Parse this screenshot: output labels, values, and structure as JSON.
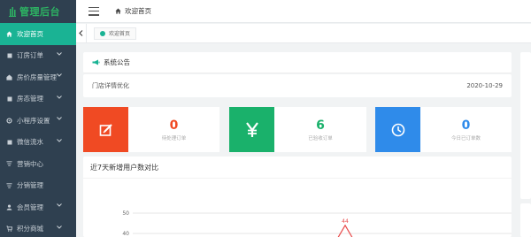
{
  "brand": {
    "name": "管理后台",
    "color": "#2db463"
  },
  "sidebar": {
    "items": [
      {
        "label": "欢迎首页",
        "icon": "home-icon",
        "active": true,
        "has_children": false
      },
      {
        "label": "订房订单",
        "icon": "square-icon",
        "has_children": true
      },
      {
        "label": "房价房量管理",
        "icon": "house-icon",
        "has_children": true
      },
      {
        "label": "房态管理",
        "icon": "square-icon",
        "has_children": true
      },
      {
        "label": "小程序设置",
        "icon": "gear-icon",
        "has_children": true
      },
      {
        "label": "微信流水",
        "icon": "square-icon",
        "has_children": true
      },
      {
        "label": "营销中心",
        "icon": "filter-icon",
        "has_children": false
      },
      {
        "label": "分销管理",
        "icon": "filter-icon",
        "has_children": false
      },
      {
        "label": "会员管理",
        "icon": "user-icon",
        "has_children": true
      },
      {
        "label": "积分商城",
        "icon": "cart-icon",
        "has_children": true
      }
    ]
  },
  "topbar": {
    "home_label": "欢迎首页"
  },
  "tabs": [
    {
      "label": "欢迎首页"
    }
  ],
  "notice": {
    "title": "系统公告",
    "items": [
      {
        "text": "门店详情优化",
        "date": "2020-10-29"
      }
    ]
  },
  "stats": [
    {
      "value": "0",
      "label": "待处理订单",
      "icon": "edit-icon",
      "color": "#f04a23"
    },
    {
      "value": "6",
      "label": "已验收订单",
      "icon": "yen-icon",
      "color": "#1ab16b"
    },
    {
      "value": "0",
      "label": "今日已订单数",
      "icon": "clock-icon",
      "color": "#2f8bea"
    }
  ],
  "chart": {
    "title": "近7天新增用户数对比"
  },
  "chart_data": {
    "type": "line",
    "title": "",
    "xlabel": "",
    "ylabel": "",
    "yticks": [
      50,
      40
    ],
    "ylim": [
      0,
      50
    ],
    "points_visible": [
      {
        "label": "44",
        "value": 44
      }
    ],
    "color": "#e84a4a"
  }
}
